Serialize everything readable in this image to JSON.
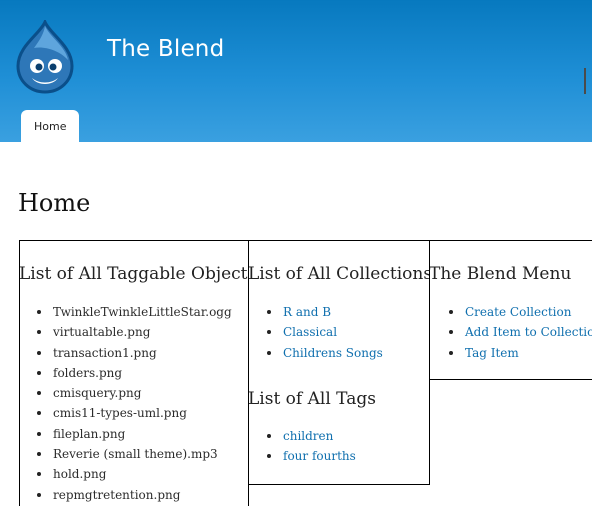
{
  "header": {
    "site_name": "The Blend",
    "logo_icon": "drupal-drop-icon",
    "tabs": [
      {
        "label": "Home",
        "active": true
      }
    ]
  },
  "main": {
    "page_title": "Home",
    "taggable_block": {
      "title": "List of All Taggable Objects",
      "items": [
        "TwinkleTwinkleLittleStar.ogg",
        "virtualtable.png",
        "transaction1.png",
        "folders.png",
        "cmisquery.png",
        "cmis11-types-uml.png",
        "fileplan.png",
        "Reverie (small theme).mp3",
        "hold.png",
        "repmgtretention.png"
      ]
    },
    "collections_block": {
      "title": "List of All Collections",
      "items": [
        "R and B",
        "Classical",
        "Childrens Songs"
      ]
    },
    "tags_block": {
      "title": "List of All Tags",
      "items": [
        "children",
        "four fourths"
      ]
    },
    "menu_block": {
      "title": "The Blend Menu",
      "items": [
        "Create Collection",
        "Add Item to Collection",
        "Tag Item"
      ]
    }
  },
  "colors": {
    "header_gradient_top": "#0779bf",
    "header_gradient_bottom": "#3aa0e0",
    "link": "#0f6fae",
    "border": "#000000"
  }
}
